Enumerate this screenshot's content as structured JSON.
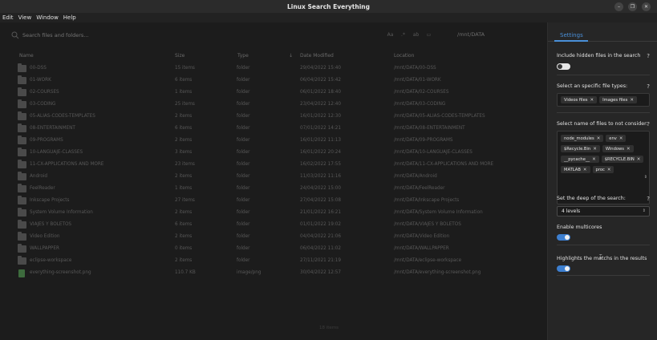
{
  "window": {
    "title": "Linux Search Everything",
    "controls": [
      "minimize-icon",
      "restore-icon",
      "close-icon"
    ]
  },
  "menu": [
    "Edit",
    "View",
    "Window",
    "Help"
  ],
  "search": {
    "placeholder": "Search files and folders...",
    "path": "/mnt/DATA"
  },
  "table": {
    "headers": {
      "name": "Name",
      "size": "Size",
      "type": "Type",
      "date": "Date Modified",
      "location": "Location"
    },
    "rows": [
      {
        "icon": "folder-icon",
        "name": "00-DSS",
        "size": "15 items",
        "type": "folder",
        "date": "29/04/2022 15:40",
        "location": "/mnt/DATA/00-DSS"
      },
      {
        "icon": "folder-icon",
        "name": "01-WORK",
        "size": "6 items",
        "type": "folder",
        "date": "06/04/2022 15:42",
        "location": "/mnt/DATA/01-WORK"
      },
      {
        "icon": "folder-icon",
        "name": "02-COURSES",
        "size": "1 items",
        "type": "folder",
        "date": "06/01/2022 18:40",
        "location": "/mnt/DATA/02-COURSES"
      },
      {
        "icon": "folder-icon",
        "name": "03-CODING",
        "size": "25 items",
        "type": "folder",
        "date": "23/04/2022 12:40",
        "location": "/mnt/DATA/03-CODING"
      },
      {
        "icon": "folder-icon",
        "name": "05-ALIAS-CODES-TEMPLATES",
        "size": "2 items",
        "type": "folder",
        "date": "16/01/2022 12:30",
        "location": "/mnt/DATA/05-ALIAS-CODES-TEMPLATES"
      },
      {
        "icon": "folder-icon",
        "name": "08-ENTERTAINMENT",
        "size": "6 items",
        "type": "folder",
        "date": "07/01/2022 14:21",
        "location": "/mnt/DATA/08-ENTERTAINMENT"
      },
      {
        "icon": "folder-icon",
        "name": "09-PROGRAMS",
        "size": "2 items",
        "type": "folder",
        "date": "16/01/2022 11:13",
        "location": "/mnt/DATA/09-PROGRAMS"
      },
      {
        "icon": "folder-icon",
        "name": "10-LANGUAJE-CLASSES",
        "size": "3 items",
        "type": "folder",
        "date": "16/01/2022 20:24",
        "location": "/mnt/DATA/10-LANGUAJE-CLASSES"
      },
      {
        "icon": "folder-icon",
        "name": "11-CX-APPLICATIONS AND MORE",
        "size": "23 items",
        "type": "folder",
        "date": "16/02/2022 17:55",
        "location": "/mnt/DATA/11-CX-APPLICATIONS AND MORE"
      },
      {
        "icon": "folder-icon",
        "name": "Android",
        "size": "2 items",
        "type": "folder",
        "date": "11/03/2022 11:16",
        "location": "/mnt/DATA/Android"
      },
      {
        "icon": "folder-icon",
        "name": "FeelReader",
        "size": "1 items",
        "type": "folder",
        "date": "24/04/2022 15:00",
        "location": "/mnt/DATA/FeelReader"
      },
      {
        "icon": "folder-icon",
        "name": "Inkscape Projects",
        "size": "27 items",
        "type": "folder",
        "date": "27/04/2022 15:08",
        "location": "/mnt/DATA/Inkscape Projects"
      },
      {
        "icon": "folder-icon",
        "name": "System Volume Information",
        "size": "2 items",
        "type": "folder",
        "date": "21/01/2022 16:21",
        "location": "/mnt/DATA/System Volume Information"
      },
      {
        "icon": "folder-icon",
        "name": "VIAJES Y BOLETOS",
        "size": "6 items",
        "type": "folder",
        "date": "01/01/2022 19:02",
        "location": "/mnt/DATA/VIAJES Y BOLETOS"
      },
      {
        "icon": "folder-icon",
        "name": "Video Edition",
        "size": "2 items",
        "type": "folder",
        "date": "04/04/2022 21:06",
        "location": "/mnt/DATA/Video Edition"
      },
      {
        "icon": "folder-icon",
        "name": "WALLPAPPER",
        "size": "0 items",
        "type": "folder",
        "date": "06/04/2022 11:02",
        "location": "/mnt/DATA/WALLPAPPER"
      },
      {
        "icon": "folder-icon",
        "name": "eclipse-workspace",
        "size": "2 items",
        "type": "folder",
        "date": "27/11/2021 21:19",
        "location": "/mnt/DATA/eclipse-workspace"
      },
      {
        "icon": "image-file-icon",
        "name": "everything-screenshot.png",
        "size": "110.7 KB",
        "type": "image/png",
        "date": "30/04/2022 12:57",
        "location": "/mnt/DATA/everything-screenshot.png"
      }
    ]
  },
  "status": "18 items",
  "settings": {
    "tab": "Settings",
    "hidden_files": {
      "label": "Include hidden files in the search",
      "help": "?",
      "enabled": false
    },
    "file_types": {
      "label": "Select an specific file types:",
      "help": "?",
      "chips": [
        "Videos files",
        "Images files"
      ]
    },
    "exclude_names": {
      "label": "Select name of files to not consider:",
      "help": "?",
      "chips": [
        "node_modules",
        "env",
        "$Recycle.Bin",
        "Windows",
        "__pycache__",
        "$RECYCLE.BIN",
        "MATLAB",
        "proc"
      ]
    },
    "depth": {
      "label": "Set the deep of the search:",
      "help": "?",
      "value": "4 levels"
    },
    "multicores": {
      "label": "Enable multicores",
      "enabled": true
    },
    "highlights": {
      "label": "Highlights the matchs in the results",
      "enabled": true
    }
  },
  "colors": {
    "accent": "#3d7fd0",
    "tab_accent": "#4a90d9",
    "panel_bg": "#262626",
    "main_bg": "#1c1c1c"
  }
}
